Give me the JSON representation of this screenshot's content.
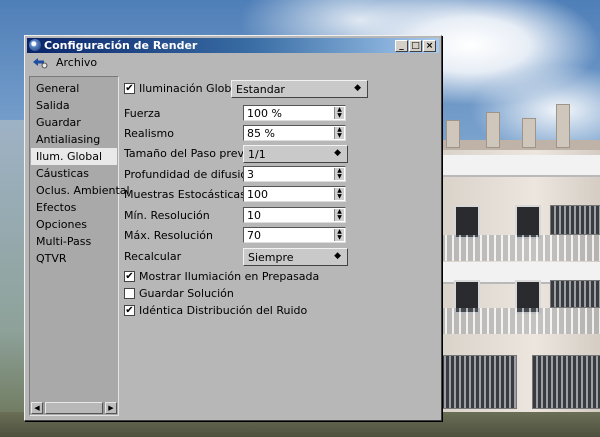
{
  "window": {
    "title": "Configuración de Render",
    "buttons": {
      "minimize": "_",
      "maximize": "□",
      "close": "×"
    }
  },
  "menubar": {
    "archivo": "Archivo"
  },
  "sidebar": {
    "items": [
      {
        "label": "General",
        "selected": false
      },
      {
        "label": "Salida",
        "selected": false
      },
      {
        "label": "Guardar",
        "selected": false
      },
      {
        "label": "Antialiasing",
        "selected": false
      },
      {
        "label": "Ilum. Global",
        "selected": true
      },
      {
        "label": "Cáusticas",
        "selected": false
      },
      {
        "label": "Oclus. Ambiental",
        "selected": false
      },
      {
        "label": "Efectos",
        "selected": false
      },
      {
        "label": "Opciones",
        "selected": false
      },
      {
        "label": "Multi-Pass",
        "selected": false
      },
      {
        "label": "QTVR",
        "selected": false
      }
    ]
  },
  "gi": {
    "enable_label": "Iluminación Global",
    "enabled": true,
    "mode": "Estandar",
    "fuerza": {
      "label": "Fuerza",
      "value": "100 %"
    },
    "realismo": {
      "label": "Realismo",
      "value": "85 %"
    },
    "tamano_paso": {
      "label": "Tamaño del Paso previo",
      "value": "1/1"
    },
    "profundidad": {
      "label": "Profundidad de difusión",
      "value": "3"
    },
    "muestras": {
      "label": "Muestras Estocásticas",
      "value": "100"
    },
    "min_res": {
      "label": "Mín. Resolución",
      "value": "10"
    },
    "max_res": {
      "label": "Máx. Resolución",
      "value": "70"
    },
    "recalcular": {
      "label": "Recalcular",
      "value": "Siempre"
    },
    "mostrar": {
      "label": "Mostrar Ilumiación en Prepasada",
      "checked": true
    },
    "guardar": {
      "label": "Guardar Solución",
      "checked": false
    },
    "identica": {
      "label": "Idéntica Distribución del Ruido",
      "checked": true
    }
  },
  "glyphs": {
    "check": "✔",
    "dropdown_arrow": "◆",
    "spin_up": "▲",
    "spin_down": "▼",
    "scroll_left": "◀",
    "scroll_right": "▶"
  },
  "colors": {
    "title_start": "#0a246a",
    "title_end": "#a6caf0",
    "panel_bg": "#b7b7b7",
    "selected_bg": "#e9e9e9"
  }
}
